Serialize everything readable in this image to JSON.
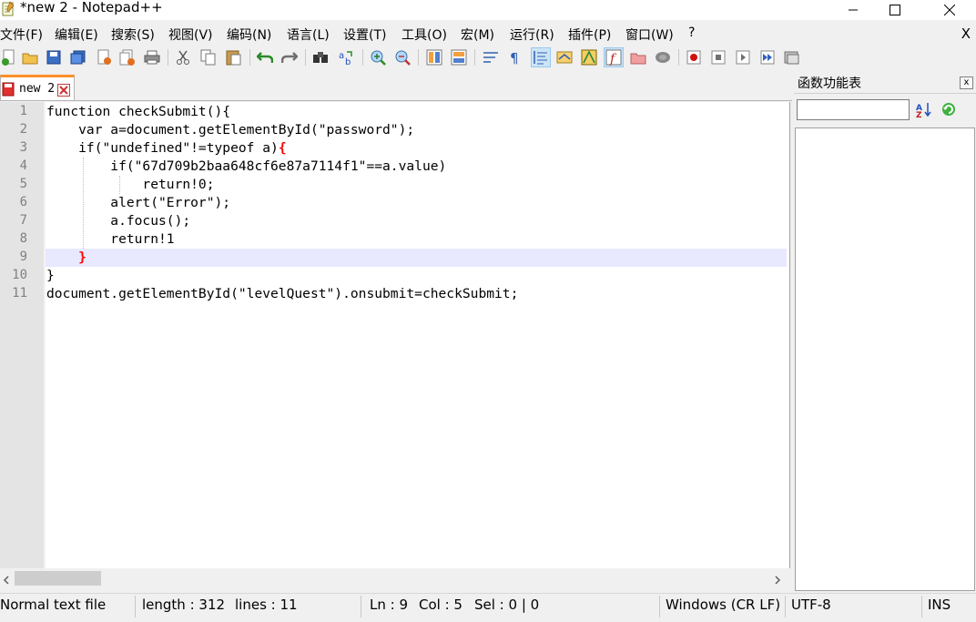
{
  "window": {
    "title": "*new 2 - Notepad++",
    "minimize": "—",
    "maximize": "☐",
    "close": "✕"
  },
  "menu": {
    "items": [
      "文件(F)",
      "编辑(E)",
      "搜索(S)",
      "视图(V)",
      "编码(N)",
      "语言(L)",
      "设置(T)",
      "工具(O)",
      "宏(M)",
      "运行(R)",
      "插件(P)",
      "窗口(W)",
      "?"
    ],
    "close": "X"
  },
  "tab": {
    "label": "new 2"
  },
  "editor": {
    "line_numbers": [
      "1",
      "2",
      "3",
      "4",
      "5",
      "6",
      "7",
      "8",
      "9",
      "10",
      "11"
    ],
    "lines": [
      "function checkSubmit(){",
      "    var a=document.getElementById(\"password\");",
      "    if(\"undefined\"!=typeof a)",
      "        if(\"67d709b2baa648cf6e87a7114f1\"==a.value)",
      "            return!0;",
      "        alert(\"Error\");",
      "        a.focus();",
      "        return!1",
      "    ",
      "}",
      "document.getElementById(\"levelQuest\").onsubmit=checkSubmit;"
    ],
    "brace_open": "{",
    "brace_close": "}"
  },
  "function_list": {
    "title": "函数功能表",
    "close": "x",
    "search_value": ""
  },
  "status": {
    "file_type": "Normal text file",
    "length": "length : 312",
    "lines": "lines : 11",
    "ln": "Ln : 9",
    "col": "Col : 5",
    "sel": "Sel : 0 | 0",
    "eol": "Windows (CR LF)",
    "encoding": "UTF-8",
    "mode": "INS"
  }
}
